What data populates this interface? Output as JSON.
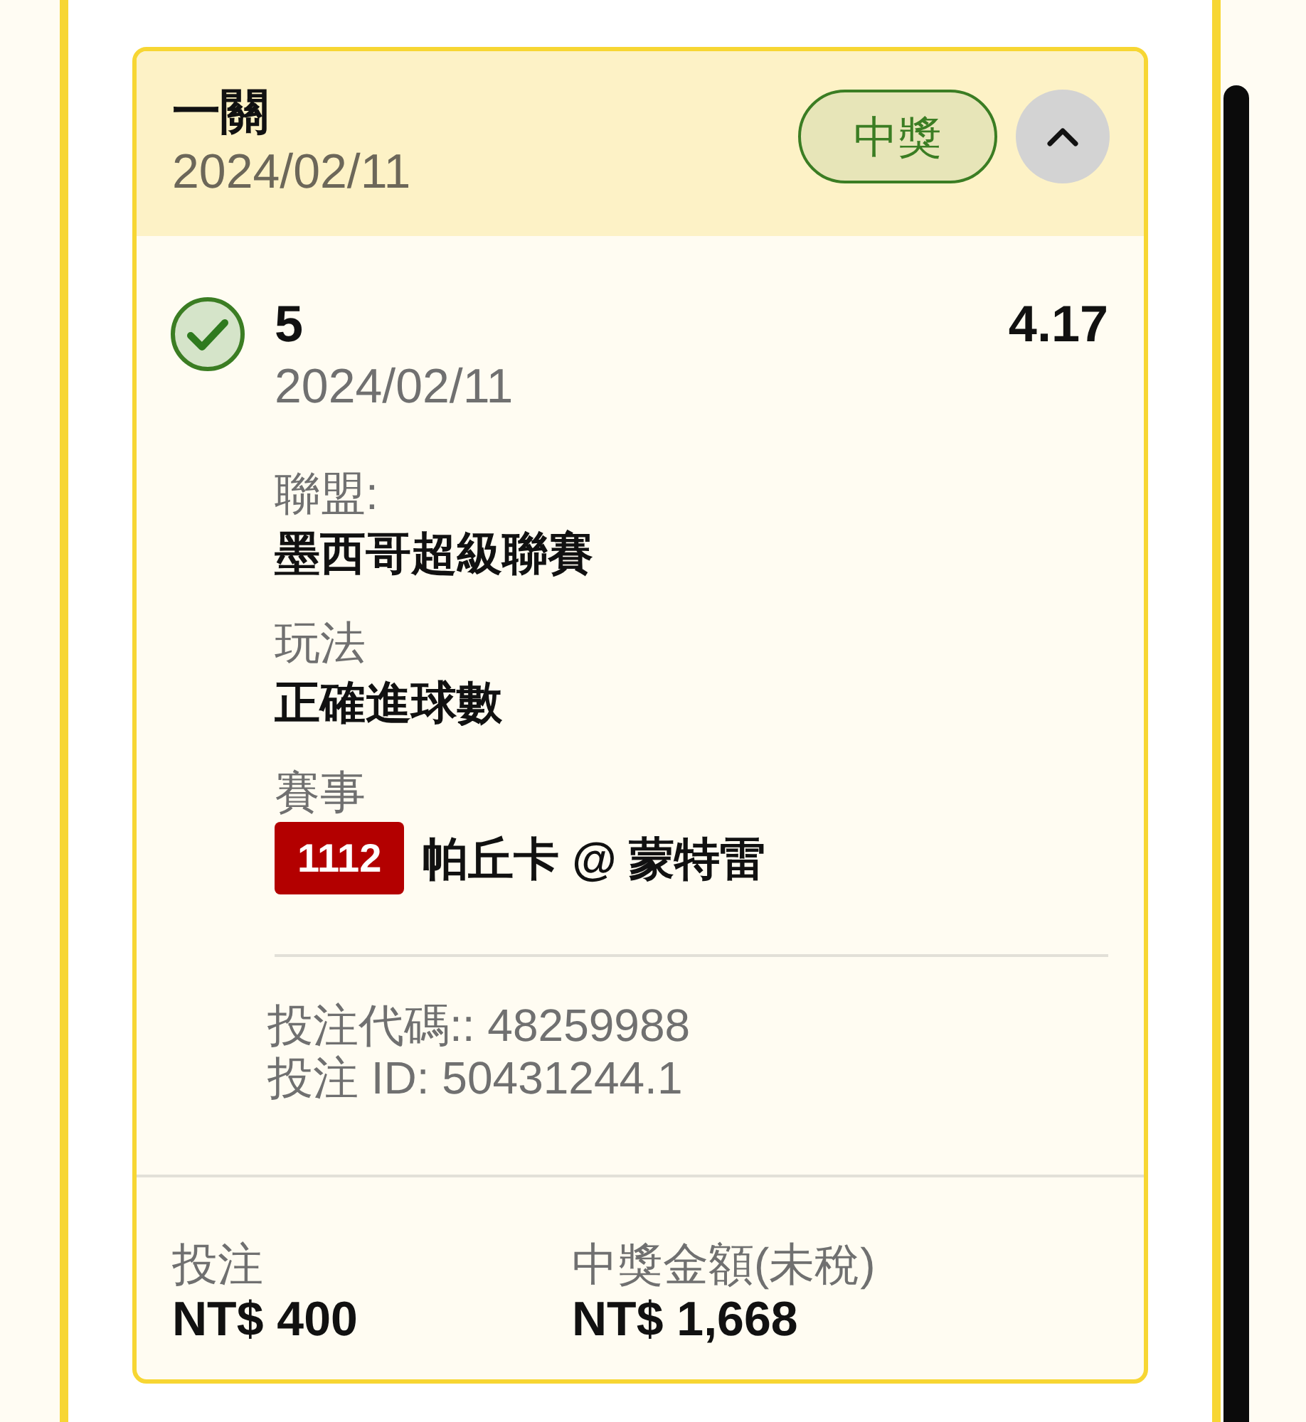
{
  "card": {
    "title": "一關",
    "date": "2024/02/11",
    "result_badge": "中獎",
    "expanded": true,
    "selection": {
      "won": true,
      "pick": "5",
      "odds": "4.17",
      "date": "2024/02/11",
      "details": [
        {
          "label": "聯盟:",
          "value": "墨西哥超級聯賽"
        },
        {
          "label": "玩法",
          "value": "正確進球數"
        },
        {
          "label": "賽事",
          "match_code": "1112",
          "value": "帕丘卡 @ 蒙特雷"
        }
      ]
    },
    "bet_code": "投注代碼:: 48259988",
    "bet_id": "投注 ID: 50431244.1",
    "footer": [
      {
        "label": "投注",
        "value": "NT$ 400"
      },
      {
        "label": "中獎金額(未稅)",
        "value": "NT$ 1,668"
      }
    ]
  }
}
